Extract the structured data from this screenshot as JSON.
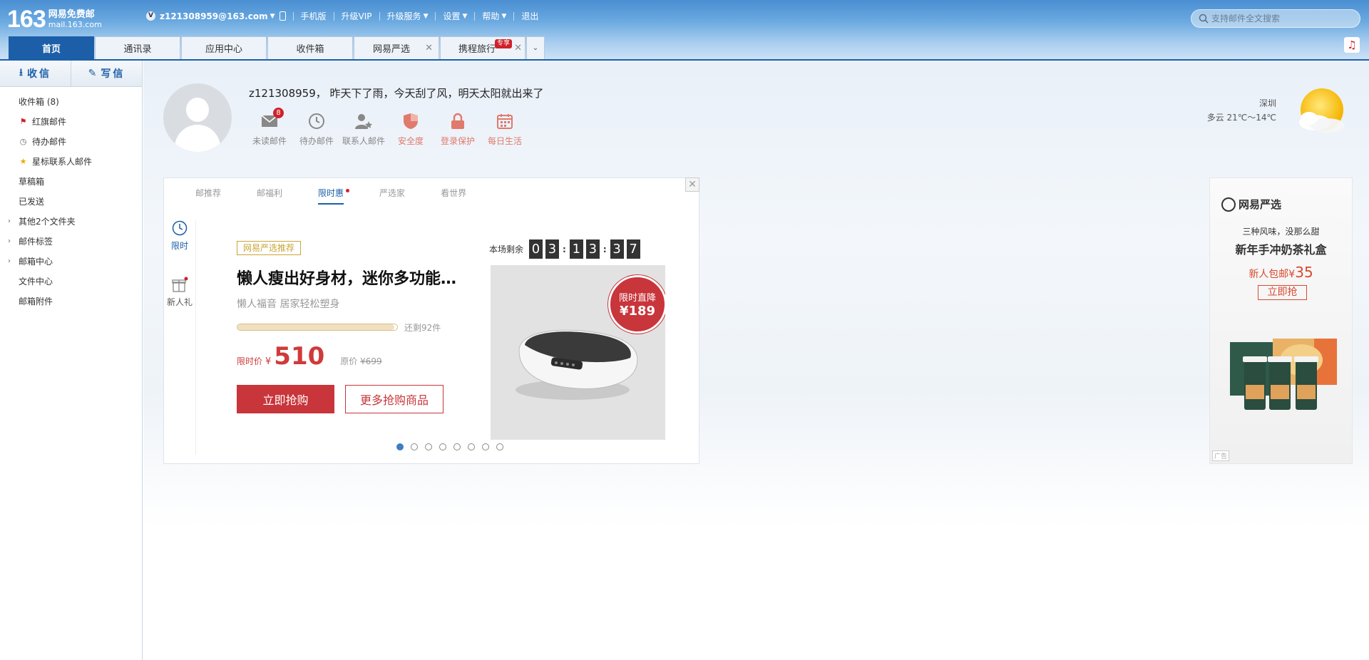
{
  "header": {
    "logo_num": "163",
    "logo_title": "网易免费邮",
    "logo_domain": "mail.163.com",
    "user_badge": "V",
    "user_email": "z121308959@163.com",
    "nav": [
      "手机版",
      "升级VIP",
      "升级服务",
      "设置",
      "帮助",
      "退出"
    ],
    "search_placeholder": "支持邮件全文搜索",
    "music_icon": "music-icon"
  },
  "tabs": [
    {
      "label": "首页",
      "active": true
    },
    {
      "label": "通讯录"
    },
    {
      "label": "应用中心"
    },
    {
      "label": "收件箱"
    },
    {
      "label": "网易严选",
      "closable": true
    },
    {
      "label": "携程旅行",
      "closable": true,
      "badge": "专享"
    }
  ],
  "sidebar": {
    "receive": "收信",
    "write": "写信",
    "folders": [
      {
        "label": "收件箱 (8)"
      },
      {
        "label": "红旗邮件",
        "icon": "flag-icon"
      },
      {
        "label": "待办邮件",
        "icon": "clock-icon"
      },
      {
        "label": "星标联系人邮件",
        "icon": "star-icon"
      },
      {
        "label": "草稿箱"
      },
      {
        "label": "已发送"
      },
      {
        "label": "其他2个文件夹",
        "expand": true
      },
      {
        "label": "邮件标签",
        "expand": true
      },
      {
        "label": "邮箱中心",
        "expand": true
      },
      {
        "label": "文件中心"
      },
      {
        "label": "邮箱附件"
      }
    ]
  },
  "home": {
    "greeting": "z121308959， 昨天下了雨，今天刮了风，明天太阳就出来了",
    "quick": [
      {
        "label": "未读邮件",
        "count": "8",
        "icon": "mail-icon"
      },
      {
        "label": "待办邮件",
        "icon": "clock-icon"
      },
      {
        "label": "联系人邮件",
        "icon": "contact-star-icon"
      },
      {
        "label": "安全度",
        "icon": "shield-icon"
      },
      {
        "label": "登录保护",
        "icon": "lock-icon"
      },
      {
        "label": "每日生活",
        "icon": "calendar-icon"
      }
    ],
    "weather": {
      "city": "深圳",
      "desc": "多云 21℃～14℃",
      "icon": "sun-cloud-icon"
    }
  },
  "promo": {
    "tabs": [
      "邮推荐",
      "邮福利",
      "限时惠",
      "严选家",
      "看世界"
    ],
    "active_tab": 2,
    "side": [
      "限时",
      "新人礼"
    ],
    "tag": "网易严选推荐",
    "title": "懒人瘦出好身材，迷你多功能甩脂机",
    "subtitle": "懒人福音 居家轻松塑身",
    "stock_progress": 0.98,
    "stock_left": "还剩92件",
    "price_label": "限时价",
    "currency": "¥",
    "price": "510",
    "orig_label": "原价",
    "orig_price": "¥699",
    "buy_label": "立即抢购",
    "more_label": "更多抢购商品",
    "countdown_label": "本场剩余",
    "countdown": [
      "0",
      "3",
      "1",
      "3",
      "3",
      "7"
    ],
    "stamp_line1": "限时直降",
    "stamp_line2": "¥189",
    "pages": 8,
    "current_page": 0
  },
  "ad": {
    "brand": "网易严选",
    "line1": "三种风味，没那么甜",
    "line2": "新年手冲奶茶礼盒",
    "line3_prefix": "新人包邮¥",
    "line3_value": "35",
    "buy": "立即抢",
    "tag": "广告"
  }
}
